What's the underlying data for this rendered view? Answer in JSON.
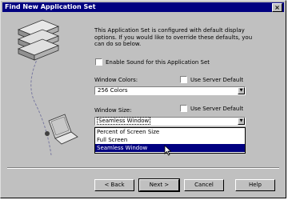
{
  "window": {
    "title": "Find New Application Set",
    "close_glyph": "×"
  },
  "intro_text": "This Application Set is configured with default display options. If you would like to override these defaults, you can do so below.",
  "enable_sound": {
    "label": "Enable Sound for this Application Set",
    "checked": false
  },
  "window_colors": {
    "label": "Window Colors:",
    "use_server_default_label": "Use Server Default",
    "use_server_default_checked": false,
    "value": "256 Colors"
  },
  "window_size": {
    "label": "Window Size:",
    "use_server_default_label": "Use Server Default",
    "use_server_default_checked": false,
    "value": "Seamless Window",
    "options": [
      "Percent of Screen Size",
      "Full Screen",
      "Seamless Window"
    ],
    "selected_index": 2
  },
  "buttons": {
    "back": "< Back",
    "next": "Next >",
    "cancel": "Cancel",
    "help": "Help"
  },
  "icons": [
    "close-icon",
    "dropdown-arrow-icon",
    "server-stack-icon",
    "laptop-icon",
    "mouse-cursor-icon"
  ]
}
